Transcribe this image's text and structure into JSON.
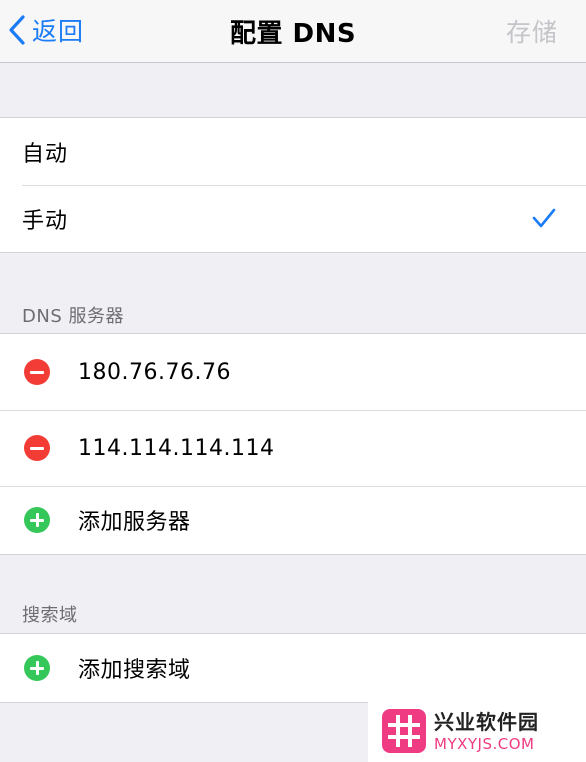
{
  "navbar": {
    "back_label": "返回",
    "title": "配置 DNS",
    "save_label": "存储",
    "accent_color": "#1b7cf5",
    "disabled_color": "#c4c4c9"
  },
  "mode_group": {
    "items": [
      {
        "label": "自动",
        "selected": false
      },
      {
        "label": "手动",
        "selected": true
      }
    ]
  },
  "dns_section": {
    "header": "DNS 服务器",
    "servers": [
      "180.76.76.76",
      "114.114.114.114"
    ],
    "add_label": "添加服务器"
  },
  "search_section": {
    "header": "搜索域",
    "add_label": "添加搜索域"
  },
  "icons": {
    "back": "chevron-left-icon",
    "check": "checkmark-icon",
    "remove": "minus-circle-icon",
    "add": "plus-circle-icon"
  },
  "colors": {
    "remove": "#f23c35",
    "add": "#35c759",
    "watermark_brand": "#ee3b82"
  },
  "watermark": {
    "name": "兴业软件园",
    "domain": "MYXYJS.COM"
  }
}
